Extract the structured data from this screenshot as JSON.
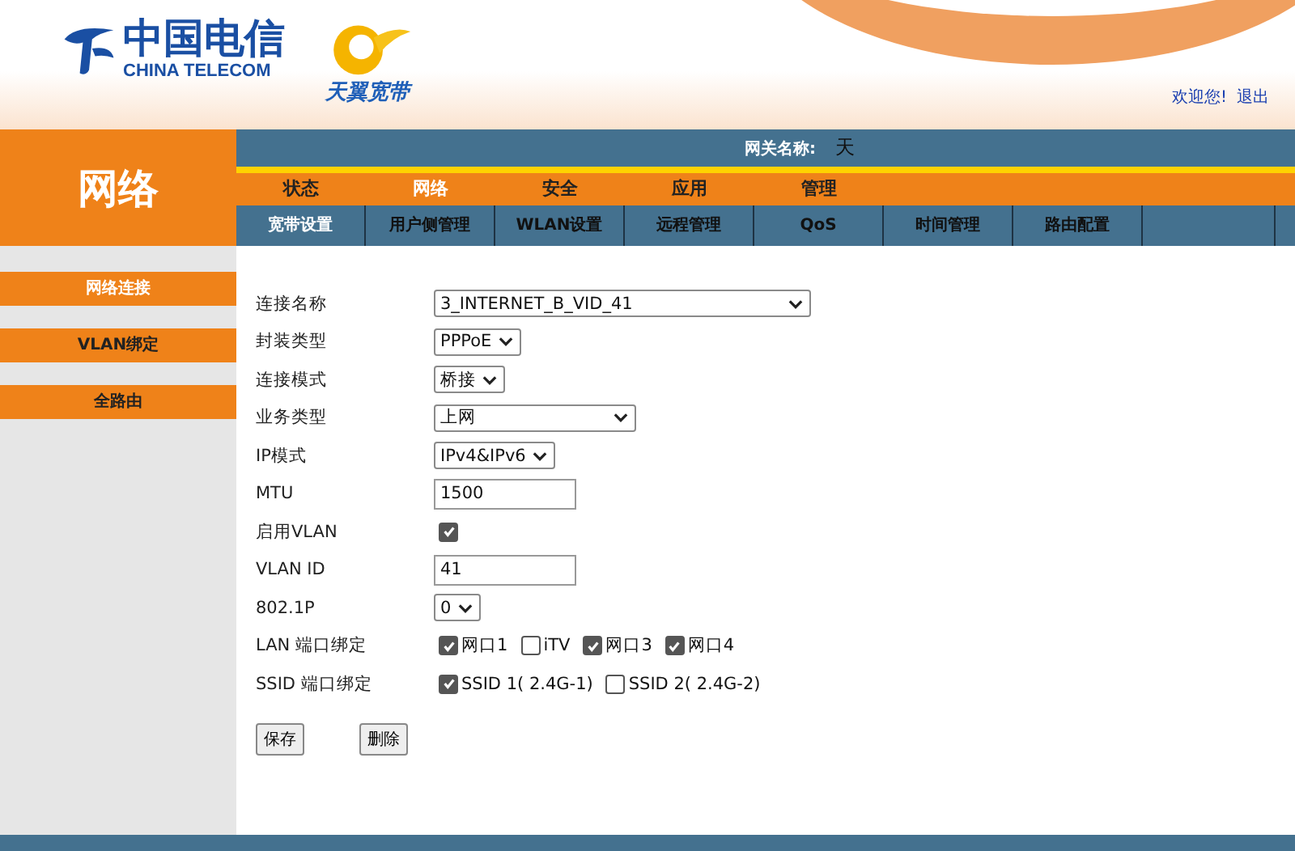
{
  "logo": {
    "name_cn": "中国电信",
    "name_en": "CHINA TELECOM"
  },
  "brand": {
    "name": "天翼宽带"
  },
  "user_links": [
    "欢迎您!",
    "退出"
  ],
  "section_title": "网络",
  "gateway": {
    "label": "网关名称:",
    "value": "天"
  },
  "main_menu": [
    {
      "label": "状态",
      "selected": false
    },
    {
      "label": "网络",
      "selected": true
    },
    {
      "label": "安全",
      "selected": false
    },
    {
      "label": "应用",
      "selected": false
    },
    {
      "label": "管理",
      "selected": false
    }
  ],
  "sub_tabs": [
    {
      "label": "宽带设置",
      "selected": true
    },
    {
      "label": "用户侧管理",
      "selected": false
    },
    {
      "label": "WLAN设置",
      "selected": false
    },
    {
      "label": "远程管理",
      "selected": false
    },
    {
      "label": "QoS",
      "selected": false
    },
    {
      "label": "时间管理",
      "selected": false
    },
    {
      "label": "路由配置",
      "selected": false
    }
  ],
  "sidebar": [
    {
      "label": "网络连接",
      "selected": true
    },
    {
      "label": "VLAN绑定",
      "selected": false
    },
    {
      "label": "全路由",
      "selected": false
    }
  ],
  "form": [
    {
      "kind": "select",
      "label": "连接名称",
      "value": "3_INTERNET_B_VID_41"
    },
    {
      "kind": "select",
      "label": "封装类型",
      "value": "PPPoE"
    },
    {
      "kind": "select",
      "label": "连接模式",
      "value": "桥接"
    },
    {
      "kind": "select",
      "label": "业务类型",
      "value": "上网"
    },
    {
      "kind": "select",
      "label": "IP模式",
      "value": "IPv4&IPv6"
    },
    {
      "kind": "text",
      "label": "MTU",
      "value": "1500"
    },
    {
      "kind": "checkbox",
      "label": "启用VLAN",
      "checked": true
    },
    {
      "kind": "text",
      "label": "VLAN ID",
      "value": "41"
    },
    {
      "kind": "select",
      "label": "802.1P",
      "value": "0"
    },
    {
      "kind": "checkgroup",
      "label": "LAN 端口绑定",
      "options": [
        {
          "label": "网口1",
          "checked": true
        },
        {
          "label": "iTV",
          "checked": false
        },
        {
          "label": "网口3",
          "checked": true
        },
        {
          "label": "网口4",
          "checked": true
        }
      ]
    },
    {
      "kind": "checkgroup",
      "label": "SSID 端口绑定",
      "options": [
        {
          "label": "SSID 1( 2.4G-1)",
          "checked": true
        },
        {
          "label": "SSID 2( 2.4G-2)",
          "checked": false
        }
      ]
    }
  ],
  "buttons": [
    "保存",
    "删除"
  ]
}
